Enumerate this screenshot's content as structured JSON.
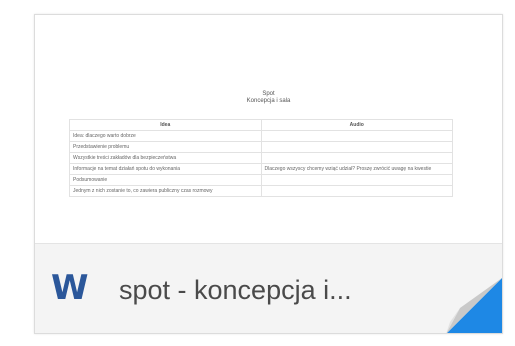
{
  "document": {
    "title_line1": "Spot",
    "title_line2": "Koncepcja i sala",
    "table": {
      "headers": [
        "Idea",
        "Audio"
      ],
      "rows": [
        [
          "Idea: dlaczego warto dobrze",
          ""
        ],
        [
          "Przedstawienie problemu",
          ""
        ],
        [
          "Wszystkie treści zakładów dla bezpieczeństwa",
          ""
        ],
        [
          "Informacje na temat działań spotu do wykonania",
          "Dlaczego wszyscy chcemy wziąć udział? Proszę zwrócić uwagę na kwestie"
        ],
        [
          "Podsumowanie",
          ""
        ],
        [
          "Jednym z nich zostanie to, co zawiera publiczny czas rozmowy",
          ""
        ]
      ]
    }
  },
  "file": {
    "name": "spot - koncepcja i...",
    "icon": "word-icon",
    "icon_letter": "W"
  },
  "colors": {
    "word_blue": "#2b579a",
    "fold_blue": "#1e88e5"
  }
}
